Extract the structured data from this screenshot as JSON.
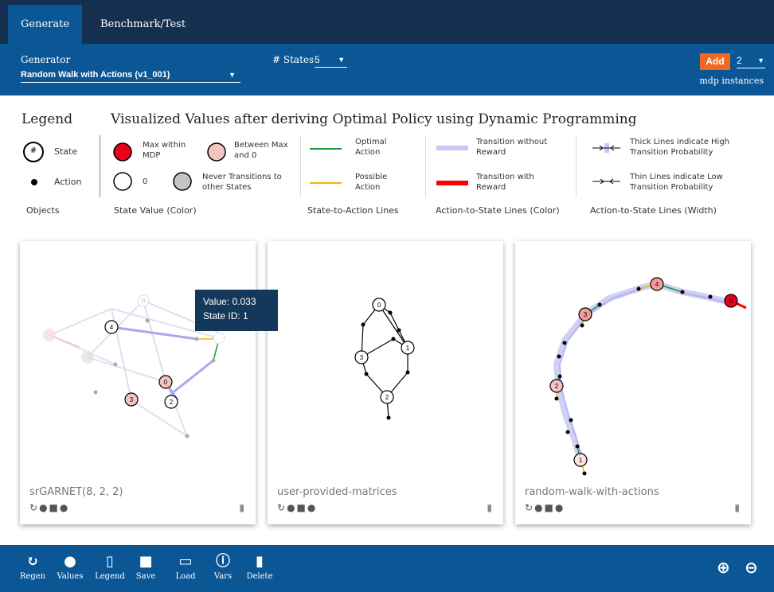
{
  "tabs": [
    {
      "label": "Generate",
      "active": true
    },
    {
      "label": "Benchmark/Test",
      "active": false
    }
  ],
  "generator": {
    "label": "Generator",
    "selected": "Random Walk with Actions (v1_001)",
    "states_label": "# States",
    "states_value": "5",
    "add_label": "Add",
    "instances_value": "2",
    "instances_label": "mdp instances"
  },
  "legend": {
    "title": "Legend",
    "viz_title": "Visualized Values after deriving Optimal Policy using Dynamic Programming",
    "state_symbol": "#",
    "state_label": "State",
    "action_label": "Action",
    "objects_caption": "Objects",
    "max_label": "Max within MDP",
    "between_label": "Between Max and 0",
    "zero_label": "0",
    "never_label": "Never Transitions to other States",
    "state_value_caption": "State Value (Color)",
    "optimal_label": "Optimal Action",
    "possible_label": "Possible Action",
    "s2a_caption": "State-to-Action Lines",
    "no_reward_label": "Transition without Reward",
    "reward_label": "Transition with Reward",
    "a2s_color_caption": "Action-to-State Lines (Color)",
    "thick_label": "Thick Lines indicate High Transition Probability",
    "thin_label": "Thin Lines indicate Low Transition Probability",
    "a2s_width_caption": "Action-to-State Lines (Width)"
  },
  "colors": {
    "max": "#e8001c",
    "between": "#f6c3c3",
    "never": "#c4c4c4",
    "optimal": "#1a9c3c",
    "possible": "#f5b800",
    "no_reward": "#c8c8f5",
    "reward": "#ff0000",
    "accent": "#0b5796",
    "add_button": "#f26722"
  },
  "cards": [
    {
      "label": "srGARNET(8, 2, 2)",
      "node_labels": [
        "4",
        "0",
        "3",
        "2",
        "0"
      ]
    },
    {
      "label": "user-provided-matrices",
      "node_labels": [
        "0",
        "3",
        "1",
        "2"
      ]
    },
    {
      "label": "random-walk-with-actions",
      "node_labels": [
        "4",
        "3",
        "0",
        "2",
        "1"
      ]
    }
  ],
  "tooltip": {
    "value": "Value: 0.033",
    "state": "State ID: 1"
  },
  "toolbar": {
    "regen": "Regen",
    "values": "Values",
    "legend": "Legend",
    "save": "Save",
    "load": "Load",
    "vars": "Vars",
    "delete": "Delete"
  }
}
